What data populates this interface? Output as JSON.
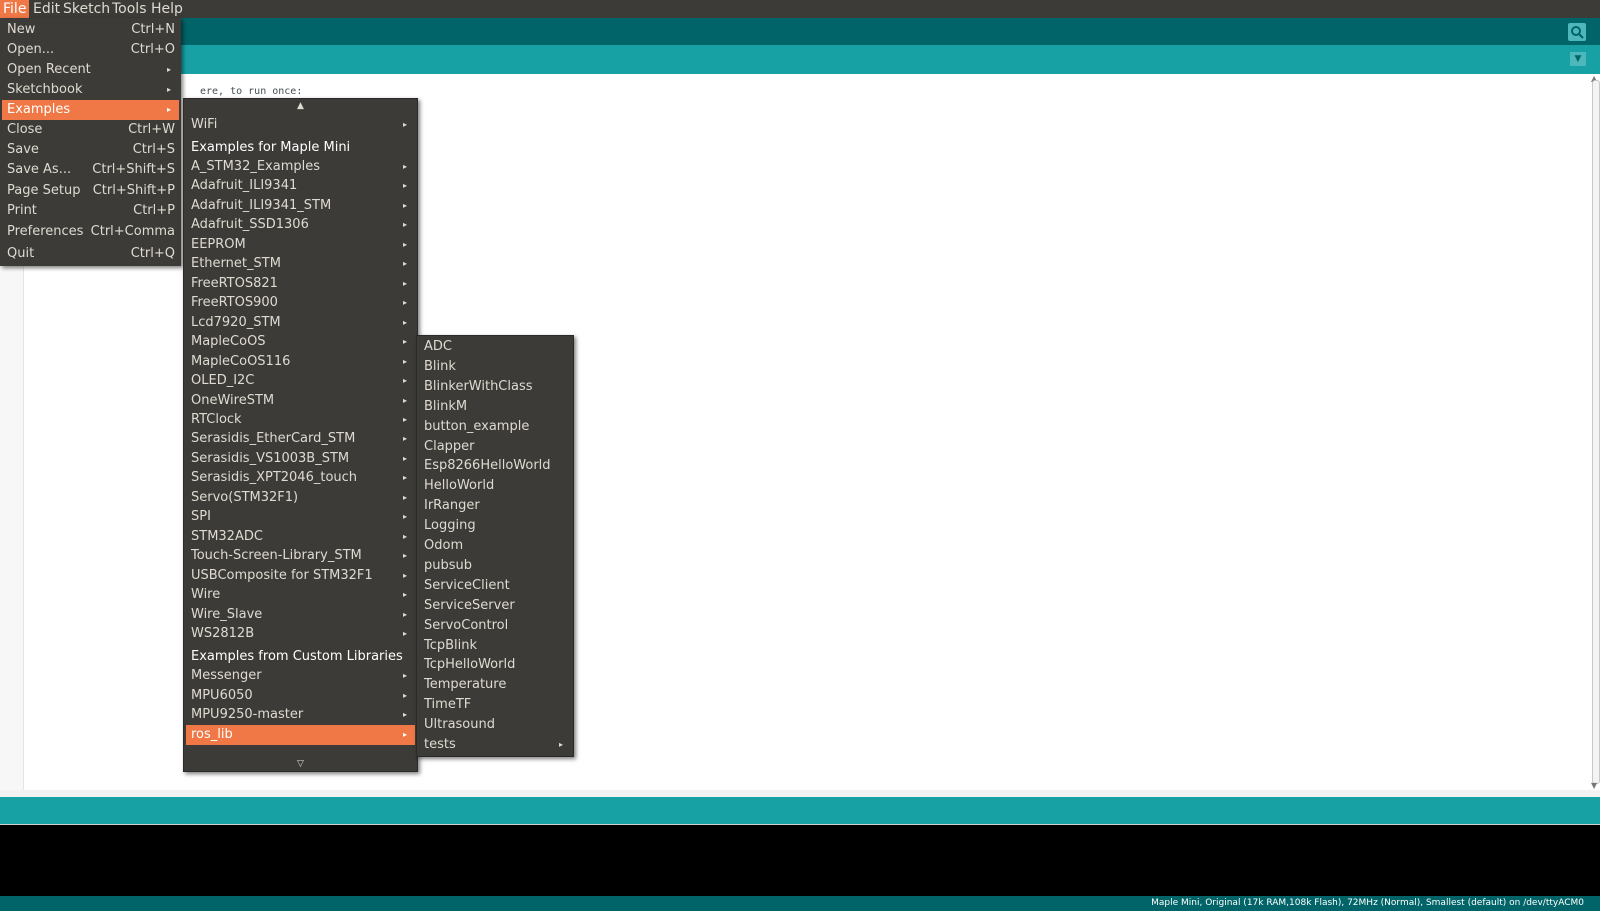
{
  "menubar": {
    "items": [
      "File",
      "Edit",
      "Sketch",
      "Tools",
      "Help"
    ]
  },
  "editor": {
    "visible_code": "ere, to run once:"
  },
  "file_menu": {
    "items": [
      {
        "label": "New",
        "shortcut": "Ctrl+N",
        "submenu": false
      },
      {
        "label": "Open...",
        "shortcut": "Ctrl+O",
        "submenu": false
      },
      {
        "label": "Open Recent",
        "shortcut": "",
        "submenu": true
      },
      {
        "label": "Sketchbook",
        "shortcut": "",
        "submenu": true
      },
      {
        "label": "Examples",
        "shortcut": "",
        "submenu": true,
        "highlighted": true
      },
      {
        "label": "Close",
        "shortcut": "Ctrl+W",
        "submenu": false
      },
      {
        "label": "Save",
        "shortcut": "Ctrl+S",
        "submenu": false
      },
      {
        "label": "Save As...",
        "shortcut": "Ctrl+Shift+S",
        "submenu": false
      },
      {
        "label": "Page Setup",
        "shortcut": "Ctrl+Shift+P",
        "submenu": false
      },
      {
        "label": "Print",
        "shortcut": "Ctrl+P",
        "submenu": false
      },
      {
        "label": "Preferences",
        "shortcut": "Ctrl+Comma",
        "submenu": false
      },
      {
        "label": "Quit",
        "shortcut": "Ctrl+Q",
        "submenu": false
      }
    ]
  },
  "examples_menu": {
    "scroll_up": "▲",
    "scroll_down": "▽",
    "items": [
      {
        "label": "WiFi",
        "type": "submenu"
      },
      {
        "label": "Examples for Maple Mini",
        "type": "header"
      },
      {
        "label": "A_STM32_Examples",
        "type": "submenu"
      },
      {
        "label": "Adafruit_ILI9341",
        "type": "submenu"
      },
      {
        "label": "Adafruit_ILI9341_STM",
        "type": "submenu"
      },
      {
        "label": "Adafruit_SSD1306",
        "type": "submenu"
      },
      {
        "label": "EEPROM",
        "type": "submenu"
      },
      {
        "label": "Ethernet_STM",
        "type": "submenu"
      },
      {
        "label": "FreeRTOS821",
        "type": "submenu"
      },
      {
        "label": "FreeRTOS900",
        "type": "submenu"
      },
      {
        "label": "Lcd7920_STM",
        "type": "submenu"
      },
      {
        "label": "MapleCoOS",
        "type": "submenu"
      },
      {
        "label": "MapleCoOS116",
        "type": "submenu"
      },
      {
        "label": "OLED_I2C",
        "type": "submenu"
      },
      {
        "label": "OneWireSTM",
        "type": "submenu"
      },
      {
        "label": "RTClock",
        "type": "submenu"
      },
      {
        "label": "Serasidis_EtherCard_STM",
        "type": "submenu"
      },
      {
        "label": "Serasidis_VS1003B_STM",
        "type": "submenu"
      },
      {
        "label": "Serasidis_XPT2046_touch",
        "type": "submenu"
      },
      {
        "label": "Servo(STM32F1)",
        "type": "submenu"
      },
      {
        "label": "SPI",
        "type": "submenu"
      },
      {
        "label": "STM32ADC",
        "type": "submenu"
      },
      {
        "label": "Touch-Screen-Library_STM",
        "type": "submenu"
      },
      {
        "label": "USBComposite for STM32F1",
        "type": "submenu"
      },
      {
        "label": "Wire",
        "type": "submenu"
      },
      {
        "label": "Wire_Slave",
        "type": "submenu"
      },
      {
        "label": "WS2812B",
        "type": "submenu"
      },
      {
        "label": "Examples from Custom Libraries",
        "type": "header"
      },
      {
        "label": "Messenger",
        "type": "submenu"
      },
      {
        "label": "MPU6050",
        "type": "submenu"
      },
      {
        "label": "MPU9250-master",
        "type": "submenu"
      },
      {
        "label": "ros_lib",
        "type": "submenu",
        "highlighted": true
      }
    ]
  },
  "roslib_menu": {
    "items": [
      {
        "label": "ADC",
        "submenu": false
      },
      {
        "label": "Blink",
        "submenu": false
      },
      {
        "label": "BlinkerWithClass",
        "submenu": false
      },
      {
        "label": "BlinkM",
        "submenu": false
      },
      {
        "label": "button_example",
        "submenu": false
      },
      {
        "label": "Clapper",
        "submenu": false
      },
      {
        "label": "Esp8266HelloWorld",
        "submenu": false
      },
      {
        "label": "HelloWorld",
        "submenu": false
      },
      {
        "label": "IrRanger",
        "submenu": false
      },
      {
        "label": "Logging",
        "submenu": false
      },
      {
        "label": "Odom",
        "submenu": false
      },
      {
        "label": "pubsub",
        "submenu": false
      },
      {
        "label": "ServiceClient",
        "submenu": false
      },
      {
        "label": "ServiceServer",
        "submenu": false
      },
      {
        "label": "ServoControl",
        "submenu": false
      },
      {
        "label": "TcpBlink",
        "submenu": false
      },
      {
        "label": "TcpHelloWorld",
        "submenu": false
      },
      {
        "label": "Temperature",
        "submenu": false
      },
      {
        "label": "TimeTF",
        "submenu": false
      },
      {
        "label": "Ultrasound",
        "submenu": false
      },
      {
        "label": "tests",
        "submenu": true
      }
    ]
  },
  "statusbar": {
    "text": "Maple Mini, Original (17k RAM,108k Flash), 72MHz (Normal), Smallest (default) on /dev/ttyACM0"
  },
  "icons": {
    "serial_monitor": "magnifier-icon",
    "tab_menu": "chevron-down-icon",
    "submenu_arrow": "▸"
  },
  "colors": {
    "menubar_bg": "#3c3b37",
    "highlight": "#f07746",
    "toolbar": "#006468",
    "tabbar": "#17a1a5"
  }
}
